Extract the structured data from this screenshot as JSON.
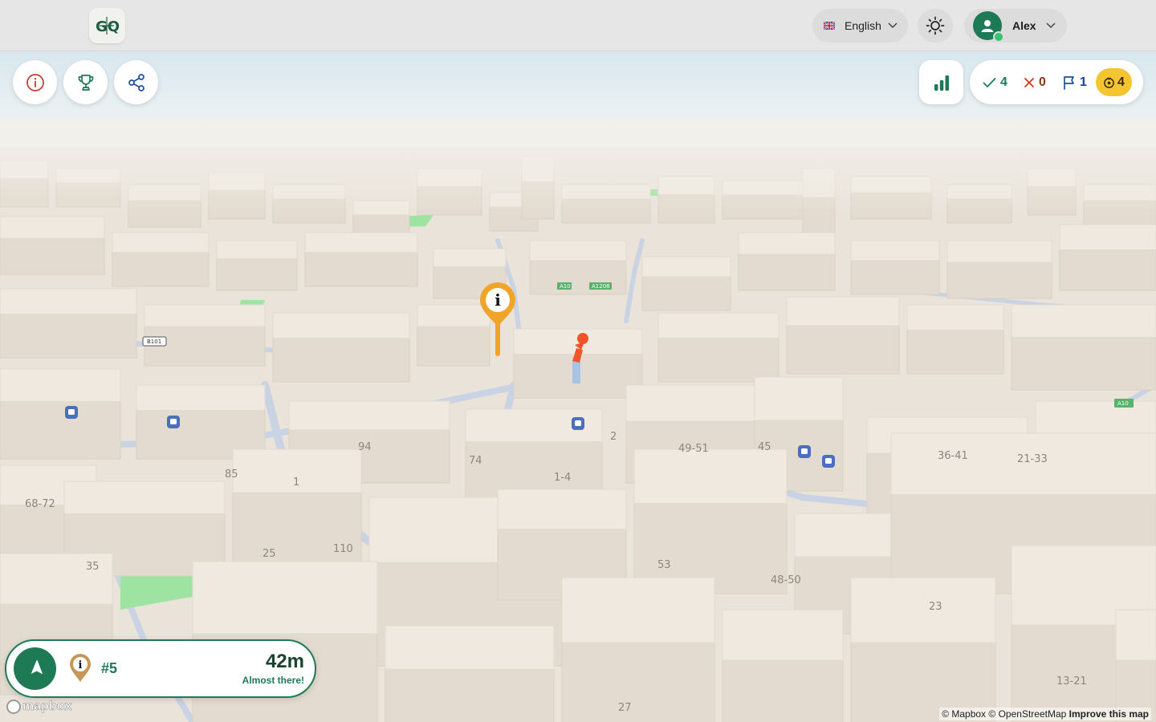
{
  "app": {
    "logo_text": "GQ"
  },
  "header": {
    "language": {
      "label": "English",
      "flag_icon": "uk-flag-icon"
    },
    "theme_icon": "sun-icon",
    "user": {
      "name": "Alex",
      "avatar_icon": "user-icon"
    }
  },
  "toolbar": {
    "info_icon": "info-icon",
    "trophy_icon": "trophy-icon",
    "share_icon": "share-icon",
    "stats_icon": "bar-chart-icon"
  },
  "score": {
    "correct": "4",
    "wrong": "0",
    "flags": "1",
    "hints": "4"
  },
  "navigation": {
    "number": "#5",
    "distance": "42m",
    "status": "Almost there!"
  },
  "map": {
    "road_labels": [
      "A10",
      "A1208",
      "B101",
      "A10"
    ],
    "house_numbers": [
      "94",
      "74",
      "2",
      "49-51",
      "45",
      "36-41",
      "21-33",
      "85",
      "1",
      "1-4",
      "68-72",
      "25",
      "110",
      "35",
      "53",
      "48-50",
      "23",
      "13-21",
      "27"
    ],
    "attribution": {
      "mapbox": "© Mapbox",
      "osm": "© OpenStreetMap",
      "improve": "Improve this map"
    },
    "logo": "mapbox"
  },
  "colors": {
    "accent": "#1e7a55",
    "hint": "#f4c531",
    "pin": "#f0a52a",
    "building": "#e8e1d6"
  }
}
